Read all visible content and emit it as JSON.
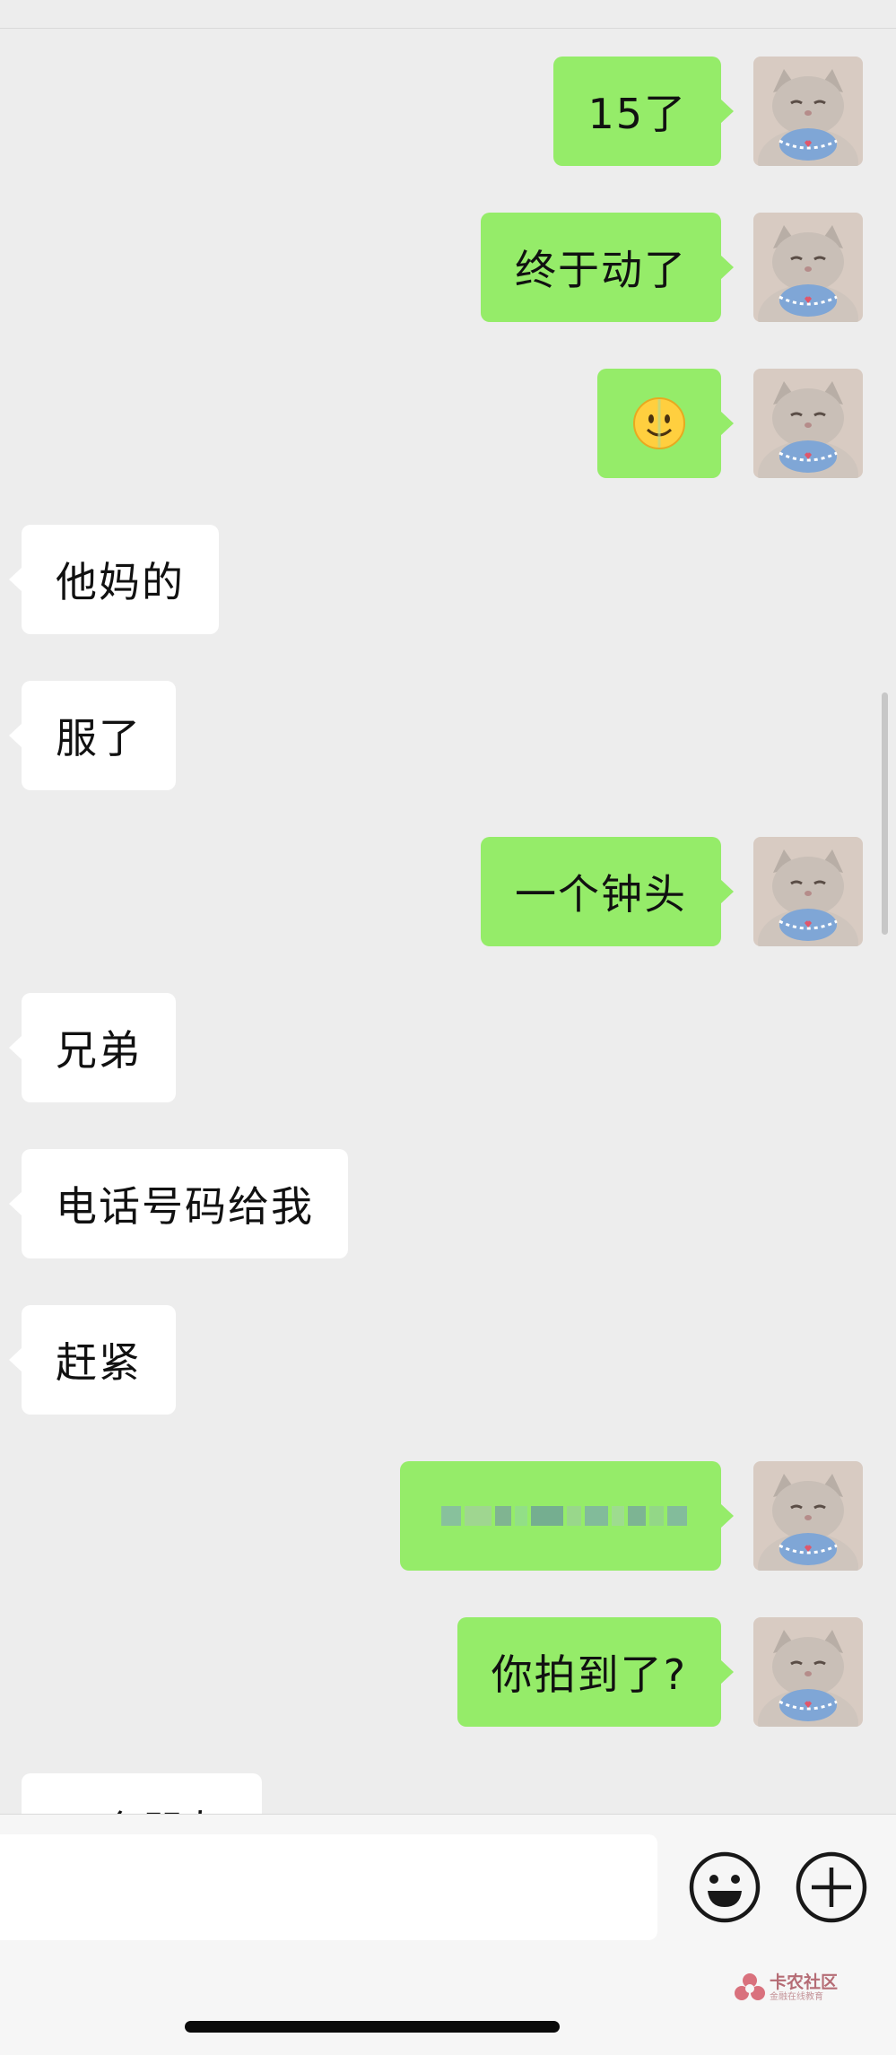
{
  "messages": [
    {
      "side": "out",
      "text": "15了"
    },
    {
      "side": "out",
      "text": "终于动了"
    },
    {
      "side": "out",
      "emoji": "melting-face-emoji"
    },
    {
      "side": "in",
      "text": "他妈的"
    },
    {
      "side": "in",
      "text": "服了"
    },
    {
      "side": "out",
      "text": "一个钟头"
    },
    {
      "side": "in",
      "text": "兄弟"
    },
    {
      "side": "in",
      "text": "电话号码给我"
    },
    {
      "side": "in",
      "text": "赶紧"
    },
    {
      "side": "out",
      "redacted": true
    },
    {
      "side": "out",
      "text": "你拍到了?"
    }
  ],
  "partial_message": {
    "text": "一个朋友"
  },
  "avatar": {
    "icon": "cat-avatar-icon"
  },
  "input_bar": {
    "input_value": "",
    "emoji_button_icon": "smiley-icon",
    "plus_button_icon": "plus-circle-icon"
  },
  "watermark": {
    "title": "卡农社区",
    "subtitle": "金融在线教育"
  },
  "colors": {
    "background": "#ededed",
    "outgoing_bubble": "#95ec69",
    "incoming_bubble": "#ffffff",
    "input_bar": "#f6f6f6"
  }
}
